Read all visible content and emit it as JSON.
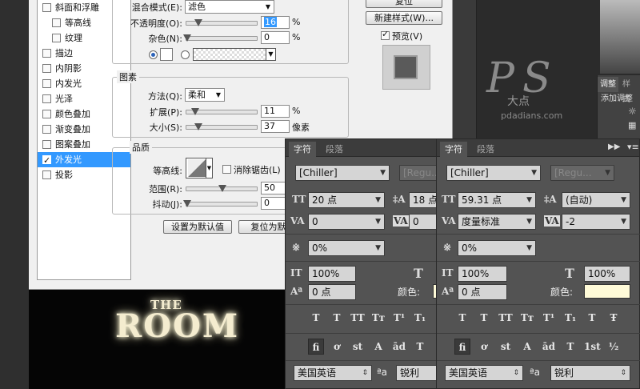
{
  "dialog": {
    "styles": [
      {
        "label": "斜面和浮雕",
        "checked": false,
        "sub": false
      },
      {
        "label": "等高线",
        "checked": false,
        "sub": true
      },
      {
        "label": "纹理",
        "checked": false,
        "sub": true
      },
      {
        "label": "描边",
        "checked": false,
        "sub": false
      },
      {
        "label": "内阴影",
        "checked": false,
        "sub": false
      },
      {
        "label": "内发光",
        "checked": false,
        "sub": false
      },
      {
        "label": "光泽",
        "checked": false,
        "sub": false
      },
      {
        "label": "颜色叠加",
        "checked": false,
        "sub": false
      },
      {
        "label": "渐变叠加",
        "checked": false,
        "sub": false
      },
      {
        "label": "图案叠加",
        "checked": false,
        "sub": false
      },
      {
        "label": "外发光",
        "checked": true,
        "sub": false,
        "selected": true
      },
      {
        "label": "投影",
        "checked": false,
        "sub": false
      }
    ],
    "structure": {
      "blend_mode_label": "混合模式(E):",
      "blend_mode_value": "滤色",
      "opacity_label": "不透明度(O):",
      "opacity_value": "16",
      "opacity_unit": "%",
      "noise_label": "杂色(N):",
      "noise_value": "0",
      "noise_unit": "%"
    },
    "elements": {
      "title": "图素",
      "method_label": "方法(Q):",
      "method_value": "柔和",
      "spread_label": "扩展(P):",
      "spread_value": "11",
      "spread_unit": "%",
      "size_label": "大小(S):",
      "size_value": "37",
      "size_unit": "像素"
    },
    "quality": {
      "title": "品质",
      "contour_label": "等高线:",
      "antialias_label": "消除锯齿(L)",
      "range_label": "范围(R):",
      "range_value": "50",
      "jitter_label": "抖动(J):",
      "jitter_value": "0"
    },
    "buttons": {
      "make_default": "设置为默认值",
      "reset_default": "复位为默认",
      "reset": "复位",
      "new_style": "新建样式(W)...",
      "preview": "预览(V)"
    }
  },
  "canvas": {
    "line1": "THE",
    "line2": "ROOM"
  },
  "watermark": {
    "logo": "PS",
    "sub": "大点",
    "url": "pdadians.com"
  },
  "right_panel": {
    "tabs": [
      "调整",
      "样式"
    ],
    "add_adjust": "添加调整"
  },
  "char_panel_1": {
    "tabs": [
      "字符",
      "段落"
    ],
    "font_family": "[Chiller]",
    "font_style": "[Regu...",
    "font_size": "20 点",
    "leading": "18 点",
    "kerning": "0",
    "tracking": "0",
    "tsume": "0%",
    "vscale": "100%",
    "baseline": "0 点",
    "color_label": "颜色:",
    "language": "美国英语",
    "aa_label": "a",
    "aa_value": "锐利",
    "color": "#fffbd8"
  },
  "char_panel_2": {
    "tabs": [
      "字符",
      "段落"
    ],
    "font_family": "[Chiller]",
    "font_style": "[Regu...",
    "font_size": "59.31 点",
    "leading": "(自动)",
    "kerning": "度量标准",
    "tracking": "-2",
    "tsume": "0%",
    "vscale": "100%",
    "hscale": "100%",
    "baseline": "0 点",
    "color_label": "颜色:",
    "language": "美国英语",
    "aa_label": "a",
    "aa_value": "锐利",
    "color": "#fffbd8"
  },
  "type_buttons_1": [
    "T",
    "T",
    "TT",
    "Tт",
    "T¹",
    "T₁"
  ],
  "type_buttons_2": [
    "T",
    "T",
    "TT",
    "Tт",
    "T¹",
    "T₁",
    "T",
    "Ŧ"
  ],
  "ot_buttons_1": [
    "fi",
    "ơ",
    "st",
    "A",
    "ād",
    "T"
  ],
  "ot_buttons_2": [
    "fi",
    "ơ",
    "st",
    "A",
    "ād",
    "T",
    "1st",
    "½"
  ]
}
